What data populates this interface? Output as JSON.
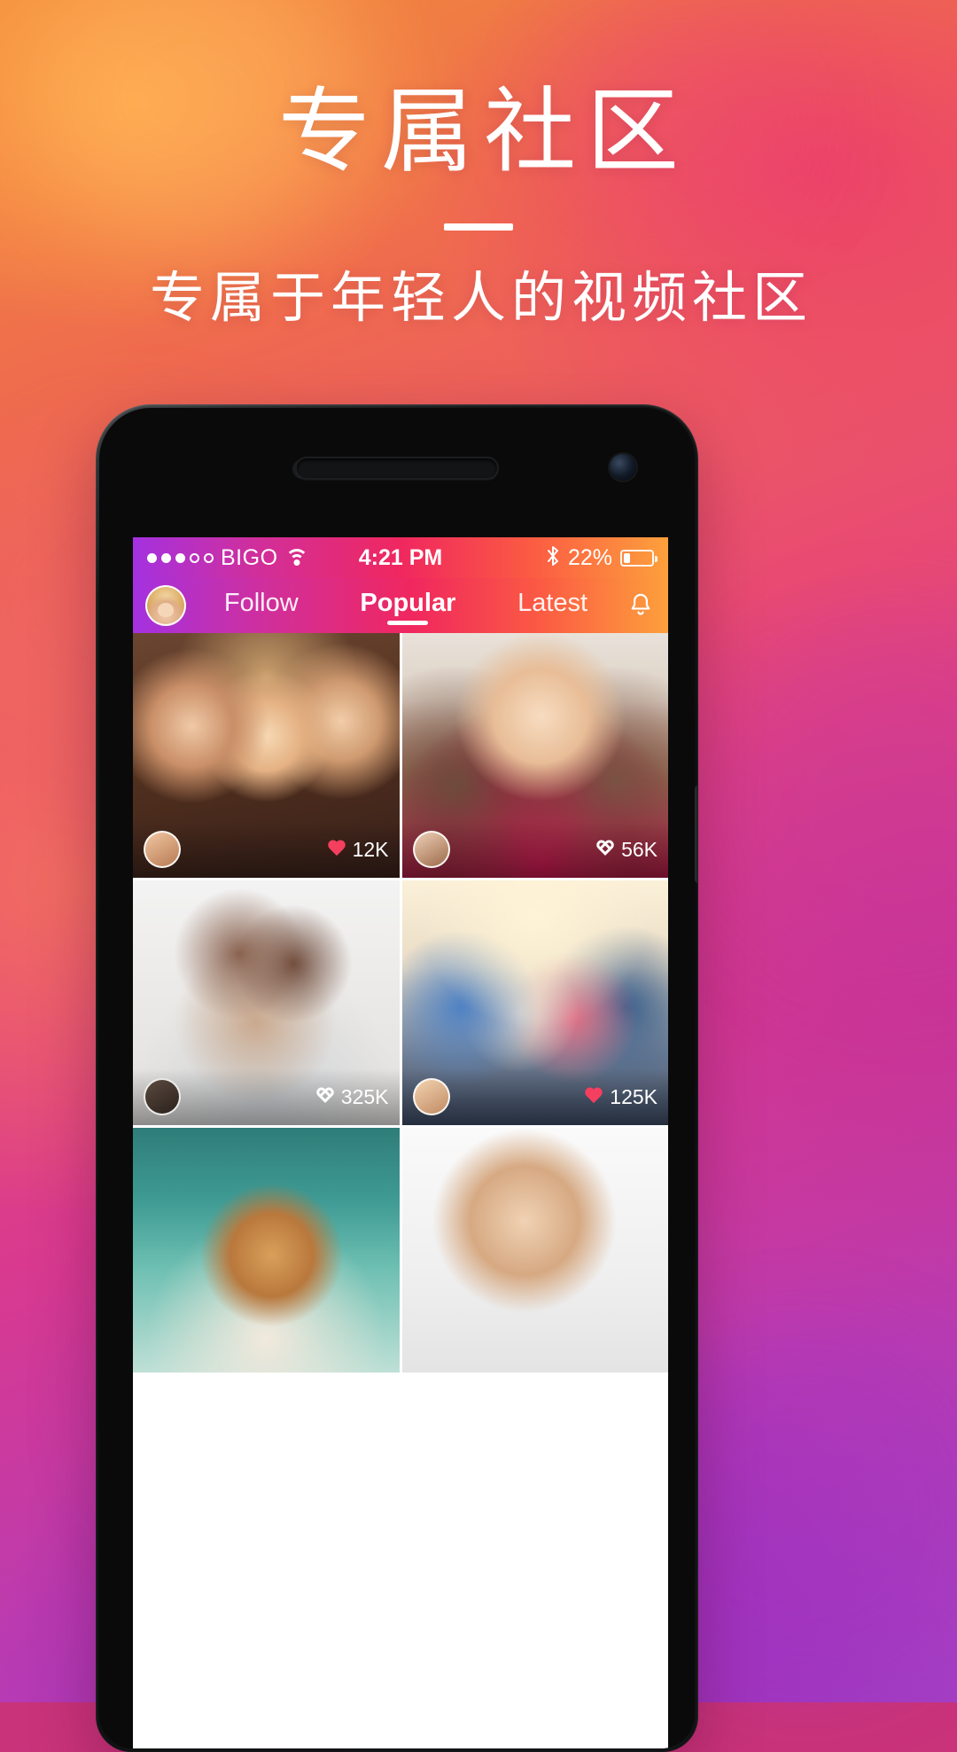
{
  "poster": {
    "title": "专属社区",
    "subtitle": "专属于年轻人的视频社区"
  },
  "colors": {
    "gradient_start": "#f08a3c",
    "gradient_mid": "#e94b72",
    "gradient_end": "#a43fc4",
    "accent_heart": "#f43f5e",
    "text_on_dark": "#ffffff"
  },
  "phone": {
    "status_bar": {
      "signal_dots_filled": 3,
      "signal_dots_total": 5,
      "carrier": "BIGO",
      "wifi_icon": "wifi-icon",
      "time": "4:21 PM",
      "bluetooth_icon": "bluetooth-icon",
      "battery_percent_label": "22%",
      "battery_level": 22
    },
    "navbar": {
      "avatar_icon": "profile-avatar",
      "tabs": [
        {
          "label": "Follow",
          "active": false
        },
        {
          "label": "Popular",
          "active": true
        },
        {
          "label": "Latest",
          "active": false
        }
      ],
      "bell_icon": "bell-icon"
    },
    "feed": {
      "items": [
        {
          "photo": "ph-party",
          "avatar": "av-a",
          "likes": "12K",
          "heart": "filled",
          "name": "party-selfie-post"
        },
        {
          "photo": "ph-girl",
          "avatar": "av-b",
          "likes": "56K",
          "heart": "outline",
          "name": "smiling-woman-post"
        },
        {
          "photo": "ph-dance",
          "avatar": "av-c",
          "likes": "325K",
          "heart": "outline",
          "name": "dancers-post"
        },
        {
          "photo": "ph-friends",
          "avatar": "av-d",
          "likes": "125K",
          "heart": "filled",
          "name": "friends-group-post"
        },
        {
          "photo": "ph-hat",
          "avatar": "av-a",
          "likes": "",
          "heart": "",
          "name": "lake-hat-post"
        },
        {
          "photo": "ph-arm",
          "avatar": "av-b",
          "likes": "",
          "heart": "",
          "name": "raised-arm-post"
        }
      ]
    }
  }
}
